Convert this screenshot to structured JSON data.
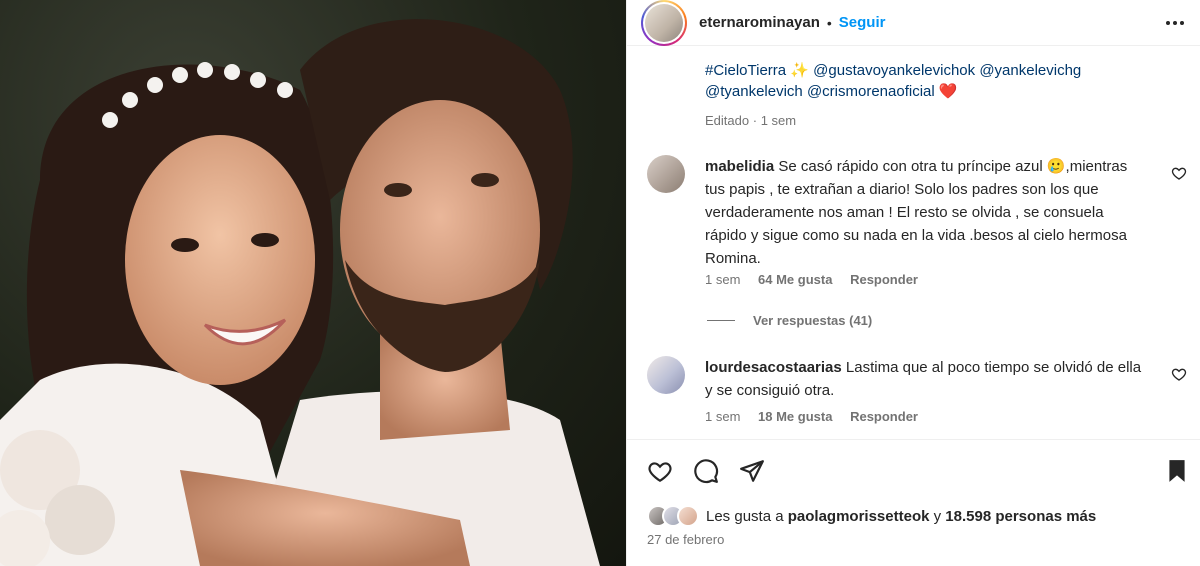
{
  "post": {
    "username": "eternarominayan",
    "separator": "•",
    "follow_label": "Seguir",
    "caption_tag1": "#CieloTierra",
    "caption_sparkle": "✨",
    "caption_tag2": "@gustavoyankelevichok",
    "caption_tag3": "@yankelevichg",
    "caption_tag4": "@tyankelevich",
    "caption_tag5": "@crismorenaoficial",
    "caption_heart": "❤️",
    "edited_label": "Editado",
    "edited_sep": "·",
    "edited_time": "1 sem"
  },
  "comments": [
    {
      "username": "mabelidia",
      "text": "Se casó rápido con otra tu príncipe azul 🥲,mientras tus papis , te extrañan a diario! Solo los padres son los que verdaderamente nos aman ! El resto se olvida , se consuela rápido y sigue como su nada en la vida .besos al cielo hermosa Romina.",
      "time": "1 sem",
      "likes": "64 Me gusta",
      "reply": "Responder",
      "view_replies": "Ver respuestas (41)"
    },
    {
      "username": "lourdesacostaarias",
      "text": "Lastima que al poco tiempo se olvidó de ella y se consiguió otra.",
      "time": "1 sem",
      "likes": "18 Me gusta",
      "reply": "Responder"
    }
  ],
  "footer": {
    "likes_prefix": "Les gusta a",
    "likes_user": "paolagmorissetteok",
    "likes_mid": "y",
    "likes_count": "18.598 personas más",
    "date": "27 de febrero"
  },
  "icons": {
    "more": "more-horizontal-icon",
    "like": "heart-icon",
    "comment": "comment-icon",
    "share": "send-icon",
    "save": "bookmark-icon"
  },
  "colors": {
    "link": "#0095f6",
    "tag": "#00376b",
    "muted": "#737373",
    "text": "#262626"
  }
}
